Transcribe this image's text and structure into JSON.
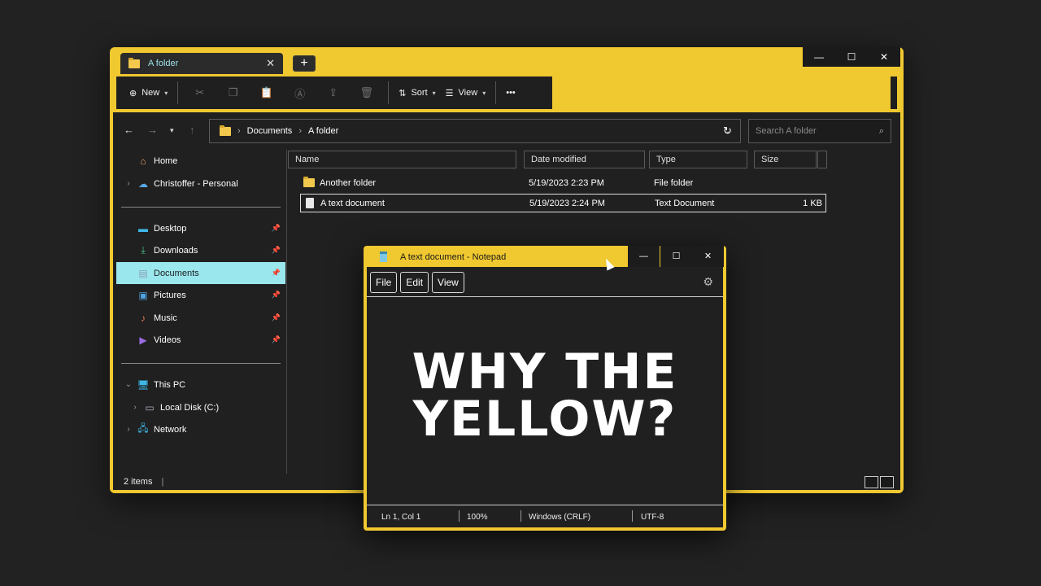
{
  "explorer": {
    "tab_label": "A folder",
    "tab_close": "✕",
    "new_tab": "+",
    "win_controls": {
      "minimize": "—",
      "maximize": "☐",
      "close": "✕"
    },
    "toolbar": {
      "new_label": "New",
      "sort_label": "Sort",
      "view_label": "View",
      "more_label": "•••"
    },
    "breadcrumb": [
      "Documents",
      "A folder"
    ],
    "search_placeholder": "Search A folder",
    "sidebar": {
      "home": "Home",
      "onedrive": "Christoffer - Personal",
      "quick": [
        "Desktop",
        "Downloads",
        "Documents",
        "Pictures",
        "Music",
        "Videos"
      ],
      "this_pc": "This PC",
      "local_disk": "Local Disk (C:)",
      "network": "Network"
    },
    "columns": [
      "Name",
      "Date modified",
      "Type",
      "Size"
    ],
    "rows": [
      {
        "name": "Another folder",
        "date": "5/19/2023 2:23 PM",
        "type": "File folder",
        "size": ""
      },
      {
        "name": "A text document",
        "date": "5/19/2023 2:24 PM",
        "type": "Text Document",
        "size": "1 KB"
      }
    ],
    "status": "2 items"
  },
  "notepad": {
    "title": "A text document - Notepad",
    "menu": [
      "File",
      "Edit",
      "View"
    ],
    "content_line1": "WHY THE",
    "content_line2": "YELLOW?",
    "status": {
      "position": "Ln 1, Col 1",
      "zoom": "100%",
      "line_ending": "Windows (CRLF)",
      "encoding": "UTF-8"
    }
  },
  "colors": {
    "accent": "#f0c830",
    "selection": "#9be7ee",
    "background": "#202020"
  }
}
